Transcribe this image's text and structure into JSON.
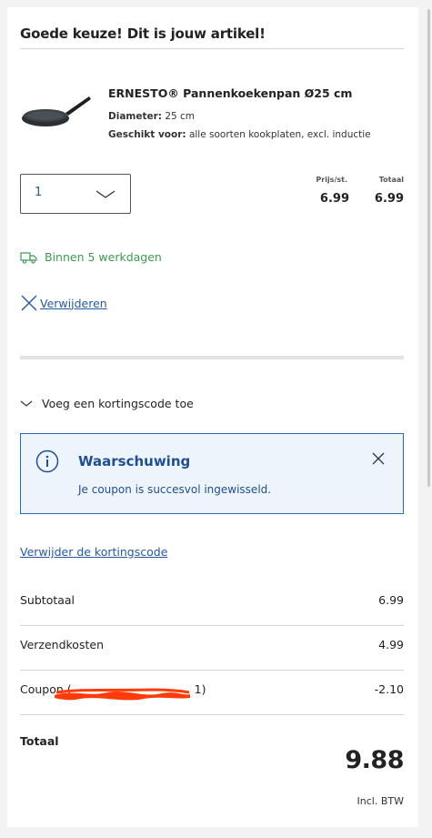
{
  "header": {
    "title": "Goede keuze! Dit is jouw artikel!"
  },
  "product": {
    "name": "ERNESTO® Pannenkoekenpan Ø25 cm",
    "diameter_label": "Diameter:",
    "diameter_value": "25 cm",
    "suitable_label": "Geschikt voor:",
    "suitable_value": "alle soorten kookplaten, excl. inductie",
    "image_icon": "frying-pan"
  },
  "quantity": {
    "value": "1",
    "chevron_icon": "chevron-down"
  },
  "price": {
    "unit_label": "Prijs/st.",
    "unit_value": "6.99",
    "total_label": "Totaal",
    "total_value": "6.99"
  },
  "delivery": {
    "text": "Binnen 5 werkdagen",
    "icon": "truck",
    "color": "#3b9a53"
  },
  "remove": {
    "label": "Verwijderen",
    "icon": "close"
  },
  "coupon": {
    "toggle_label": "Voeg een kortingscode toe",
    "warning_title": "Waarschuwing",
    "warning_message": "Je coupon is succesvol ingewisseld.",
    "remove_code_label": "Verwijder de kortingscode"
  },
  "summary": {
    "subtotal_label": "Subtotaal",
    "subtotal_value": "6.99",
    "shipping_label": "Verzendkosten",
    "shipping_value": "4.99",
    "coupon_label": "Coupon (",
    "coupon_label_end": "1)",
    "coupon_value": "-2.10",
    "total_label": "Totaal",
    "total_value": "9.88",
    "vat_note": "Incl. BTW"
  },
  "colors": {
    "accent_blue": "#2759a5",
    "warning_border": "#2a69b4",
    "warning_bg": "#eef4fb",
    "redaction": "#ff3b0a"
  }
}
